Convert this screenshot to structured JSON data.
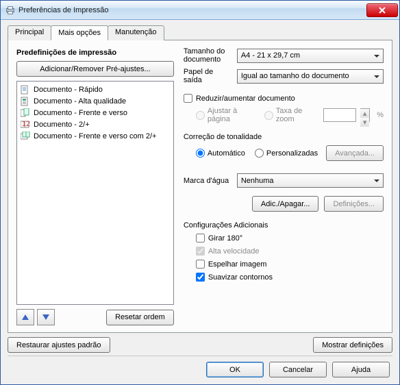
{
  "window": {
    "title": "Preferências de Impressão"
  },
  "tabs": {
    "principal": "Principal",
    "mais_opcoes": "Mais opções",
    "manutencao": "Manutenção",
    "active": "mais_opcoes"
  },
  "left": {
    "heading": "Predefinições de impressão",
    "add_remove": "Adicionar/Remover Pré-ajustes...",
    "presets": [
      "Documento - Rápido",
      "Documento - Alta qualidade",
      "Documento - Frente e verso",
      "Documento - 2/+",
      "Documento - Frente e verso com 2/+"
    ],
    "up_tip": "Mover para cima",
    "down_tip": "Mover para baixo",
    "reset_order": "Resetar ordem"
  },
  "right": {
    "doc_size_label": "Tamanho do documento",
    "doc_size_value": "A4 - 21 x 29,7 cm",
    "output_paper_label": "Papel de saída",
    "output_paper_value": "Igual ao tamanho do documento",
    "reduce_enlarge": {
      "label": "Reduzir/aumentar documento",
      "checked": false
    },
    "fit_page": "Ajustar à página",
    "zoom_rate": "Taxa de zoom",
    "percent": "%",
    "color_heading": "Correção de tonalidade",
    "color_auto": "Automático",
    "color_custom": "Personalizadas",
    "color_selected": "auto",
    "advanced": "Avançada...",
    "watermark_label": "Marca d'água",
    "watermark_value": "Nenhuma",
    "watermark_add": "Adic./Apagar...",
    "watermark_settings": "Definições...",
    "additional_heading": "Configurações Adicionais",
    "rotate180": {
      "label": "Girar 180°",
      "checked": false
    },
    "high_speed": {
      "label": "Alta velocidade",
      "checked": true,
      "disabled": true
    },
    "mirror": {
      "label": "Espelhar imagem",
      "checked": false
    },
    "smooth": {
      "label": "Suavizar contornos",
      "checked": true
    }
  },
  "footer": {
    "restore_defaults": "Restaurar ajustes padrão",
    "show_settings": "Mostrar definições"
  },
  "dialog": {
    "ok": "OK",
    "cancel": "Cancelar",
    "help": "Ajuda"
  }
}
